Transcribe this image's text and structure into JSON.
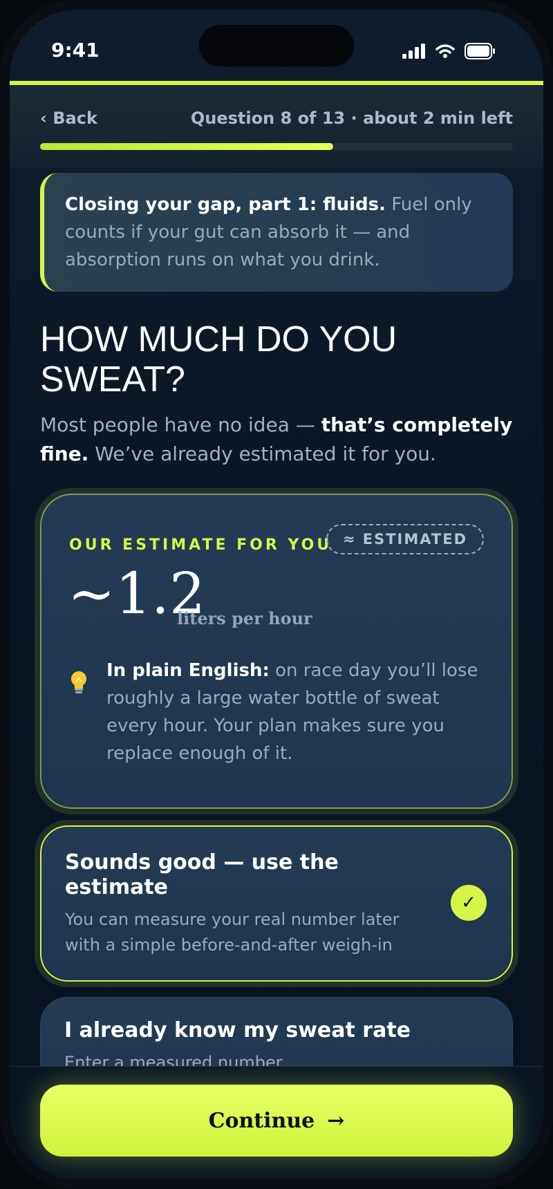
{
  "status": {
    "time": "9:41"
  },
  "header": {
    "back_label": "‹ Back",
    "progress_text": "Question 8 of 13 · about 2 min left",
    "progress": 0.62
  },
  "callout": {
    "bold": "Closing your gap, part 1: fluids.",
    "text": " Fuel only counts if your gut can absorb it — and absorption runs on what you drink."
  },
  "question": {
    "title": "HOW MUCH DO YOU SWEAT?",
    "subtitle_pre": "Most people have no idea — ",
    "subtitle_bold": "that’s completely fine.",
    "subtitle_post": " We’ve already estimated it for you."
  },
  "estimate": {
    "label": "OUR ESTIMATE FOR YOU",
    "badge": "≈ ESTIMATED",
    "value": "~1.2",
    "unit": "liters per hour",
    "note_bold": "In plain English:",
    "note_text": " on race day you’ll lose roughly a large water bottle of sweat every hour. Your plan makes sure you replace enough of it."
  },
  "options": [
    {
      "title": "Sounds good — use the estimate",
      "desc": "You can measure your real number later with a simple before-and-after weigh-in",
      "selected": true,
      "check": "✓"
    },
    {
      "title": "I already know my sweat rate",
      "desc": "Enter a measured number",
      "selected": false
    }
  ],
  "cta": {
    "label": "Continue",
    "arrow": "→"
  },
  "colors": {
    "accent": "#d7f545",
    "background": "#0b1624",
    "card": "#223a57"
  }
}
